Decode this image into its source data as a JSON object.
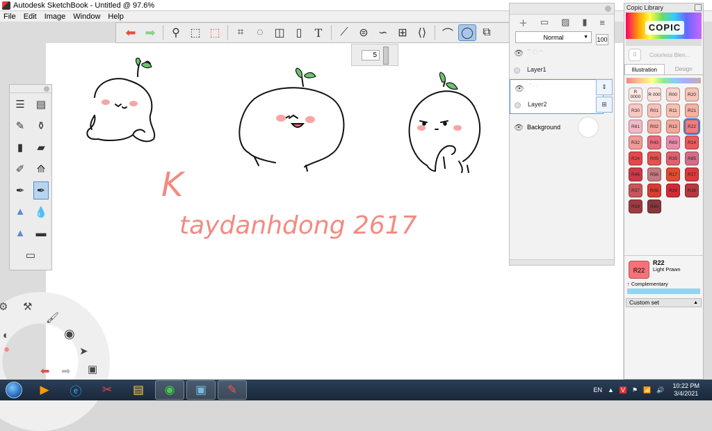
{
  "window": {
    "title": "Autodesk SketchBook - Untitled @ 97.6%",
    "menu": [
      "File",
      "Edit",
      "Image",
      "Window",
      "Help"
    ]
  },
  "toolbar": {
    "icons": [
      "undo-icon",
      "redo-icon",
      "zoom-icon",
      "select-icon",
      "transform-icon",
      "crop-icon",
      "lasso-icon",
      "distort-icon",
      "fill-icon",
      "text-icon",
      "ruler-icon",
      "ellipse-icon",
      "french-curve-icon",
      "perspective-icon",
      "symmetry-icon",
      "stroke-icon",
      "predictive-stroke-icon",
      "copic-color-icon"
    ]
  },
  "brush_size": {
    "value": "5"
  },
  "layers": {
    "blend_mode": "Normal",
    "opacity": "100",
    "items": [
      {
        "name": "Layer1"
      },
      {
        "name": "Layer2"
      },
      {
        "name": "Background"
      }
    ]
  },
  "copic": {
    "title": "Copic Library",
    "logo": "COPIC",
    "blender_label": "Colorless Blen...",
    "blender_code": "0",
    "tabs": [
      "Illustration",
      "Design"
    ],
    "swatches": [
      {
        "code": "R 0000",
        "color": "#fde8e4"
      },
      {
        "code": "R 000",
        "color": "#fbe0da"
      },
      {
        "code": "R00",
        "color": "#f9d4cc"
      },
      {
        "code": "R20",
        "color": "#f6c4b8"
      },
      {
        "code": "R30",
        "color": "#f8c8c4"
      },
      {
        "code": "R01",
        "color": "#f7c0b8"
      },
      {
        "code": "R11",
        "color": "#f6c0b0"
      },
      {
        "code": "R21",
        "color": "#f3b2a4"
      },
      {
        "code": "R81",
        "color": "#f3b8c8"
      },
      {
        "code": "R02",
        "color": "#f3a8a0"
      },
      {
        "code": "R12",
        "color": "#f3a89a"
      },
      {
        "code": "R22",
        "color": "#f07c80"
      },
      {
        "code": "R32",
        "color": "#f09a98"
      },
      {
        "code": "R43",
        "color": "#ea6a7a"
      },
      {
        "code": "R83",
        "color": "#e98cab"
      },
      {
        "code": "R14",
        "color": "#e85a5c"
      },
      {
        "code": "R24",
        "color": "#e4484c"
      },
      {
        "code": "R05",
        "color": "#e2524e"
      },
      {
        "code": "R35",
        "color": "#e06070"
      },
      {
        "code": "R85",
        "color": "#d46d8a"
      },
      {
        "code": "R46",
        "color": "#cc3a48"
      },
      {
        "code": "R56",
        "color": "#c47a80"
      },
      {
        "code": "R17",
        "color": "#e04a30"
      },
      {
        "code": "R27",
        "color": "#dc3a3c"
      },
      {
        "code": "R37",
        "color": "#c8565a"
      },
      {
        "code": "R08",
        "color": "#d83c30"
      },
      {
        "code": "R29",
        "color": "#d02c38"
      },
      {
        "code": "R39",
        "color": "#b83840"
      },
      {
        "code": "R59",
        "color": "#9c3c40"
      },
      {
        "code": "R89",
        "color": "#86383c"
      }
    ],
    "selected": {
      "code": "R22",
      "name": "Light Prawn",
      "complementary_label": "↑ Complementary",
      "complementary_color": "#8cd8f0"
    },
    "custom_set_label": "Custom set"
  },
  "canvas": {
    "handwriting_1": "K",
    "handwriting_2": "taydanhdong 2617",
    "ink_color": "#f28b82"
  },
  "taskbar": {
    "lang": "EN",
    "time": "10:22 PM",
    "date": "3/4/2021"
  }
}
